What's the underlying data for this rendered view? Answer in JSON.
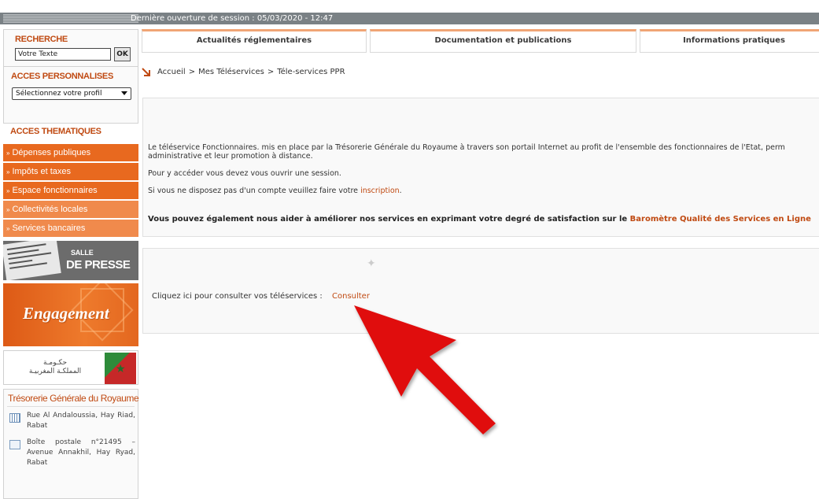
{
  "session": {
    "text": "Dernière ouverture de session : 05/03/2020 - 12:47"
  },
  "nav_tabs": [
    "Actualités réglementaires",
    "Documentation et publications",
    "Informations pratiques"
  ],
  "search": {
    "title": "RECHERCHE",
    "value": "Votre Texte",
    "button": "OK"
  },
  "personalized": {
    "title": "ACCES PERSONNALISES",
    "selected": "Sélectionnez votre profil"
  },
  "thematic": {
    "title": "ACCES THEMATIQUES",
    "items": [
      "Dépenses publiques",
      "Impôts et taxes",
      "Espace fonctionnaires",
      "Collectivités locales",
      "Services bancaires"
    ]
  },
  "promos": {
    "press_line1": "SALLE",
    "press_line2": "DE PRESSE",
    "engagement": "Engagement",
    "gov_line1": "حكـومـة",
    "gov_line2": "المملكـة المغربيـة"
  },
  "contact": {
    "org": "Trésorerie Générale du Royaume",
    "address": "Rue Al Andaloussia, Hay Riad, Rabat",
    "po_box": "Boîte postale n°21495 – Avenue Annakhil, Hay Ryad, Rabat"
  },
  "breadcrumb": [
    "Accueil",
    "Mes Téléservices",
    "Téle-services PPR"
  ],
  "content": {
    "para1_line1": "Le téléservice Fonctionnaires. mis en place par la Trésorerie Générale du Royaume à travers son portail Internet au profit de l'ensemble des fonctionnaires de l'Etat, perm",
    "para1_line2": "administrative et leur promotion à distance.",
    "para2": "Pour y accéder vous devez vous ouvrir une session.",
    "para3_prefix": "Si vous ne disposez pas d'un compte veuillez faire votre",
    "para3_link": "inscription",
    "para3_suffix": ".",
    "para4_prefix": "Vous pouvez également nous aider à améliorer nos services en exprimant votre degré de satisfaction sur le",
    "para4_link": "Baromètre Qualité des Services en Ligne"
  },
  "consult": {
    "text": "Cliquez ici pour consulter vos téléservices :",
    "link": "Consulter"
  },
  "colors": {
    "accent": "#c04a12",
    "theme_dark": "#e8691f",
    "theme_light": "#f08a4c",
    "topbar": "#7a8185",
    "red_arrow": "#e01010"
  },
  "icons": [
    "chevron-down-icon",
    "breadcrumb-arrow-icon",
    "puzzle-icon",
    "building-icon",
    "envelope-icon",
    "red-pointer-arrow"
  ]
}
